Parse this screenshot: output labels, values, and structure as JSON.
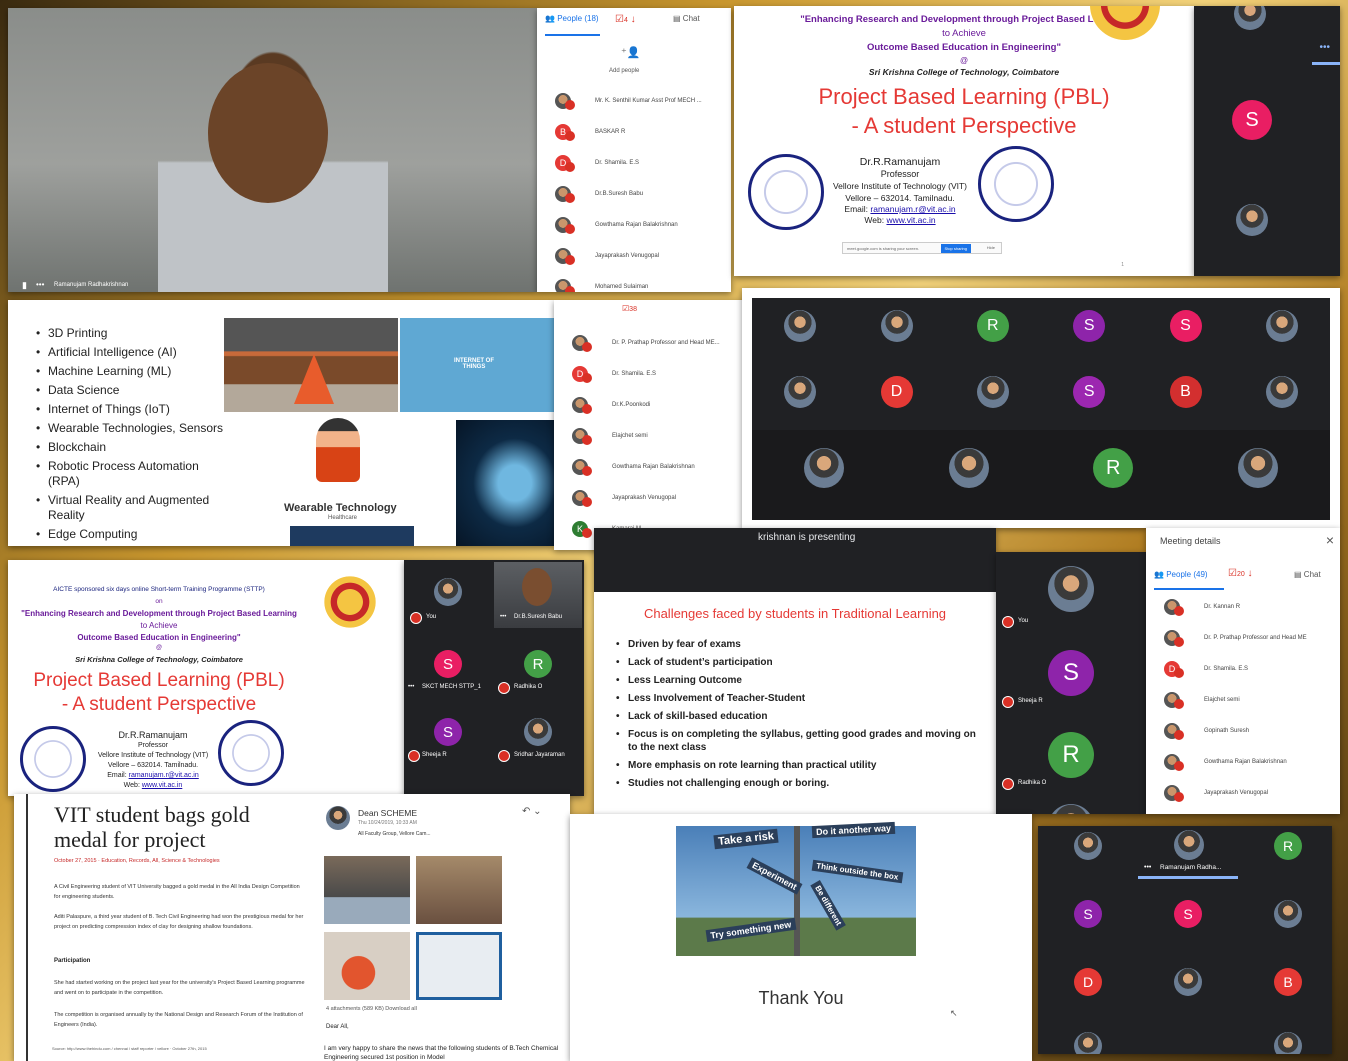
{
  "p1": {
    "name": "Ramanujam Radhakrishnan"
  },
  "people_panel_1": {
    "tab_people": "People (18)",
    "tab_chat": "Chat",
    "count": "4",
    "add_people": "Add people",
    "participants": [
      "Mr. K. Senthil Kumar Asst Prof MECH ...",
      "BASKAR R",
      "Dr. Shamila. E.S",
      "Dr.B.Suresh Babu",
      "Gowthama Rajan Balakrishnan",
      "Jayaprakash Venugopal",
      "Mohamed Sulaiman"
    ],
    "initials": [
      "",
      "B",
      "D",
      "",
      "",
      "",
      ""
    ]
  },
  "slide1": {
    "header1": "\"Enhancing Research and Development through Project Based Learning",
    "header2": "to Achieve",
    "header3": "Outcome Based Education in Engineering\"",
    "at": "@",
    "college": "Sri Krishna College of Technology, Coimbatore",
    "title": "Project Based Learning (PBL)",
    "subtitle": "- A student Perspective",
    "presenter": "Dr.R.Ramanujam",
    "role": "Professor",
    "inst": "Vellore Institute of Technology (VIT)",
    "addr": "Vellore – 632014. Tamilnadu.",
    "email_l": "Email:",
    "email": "ramanujam.r@vit.ac.in",
    "web_l": "Web:",
    "web": "www.vit.ac.in",
    "share_text": "meet.google.com is sharing your screen.",
    "stop_btn": "Stop sharing",
    "hide": "Hide",
    "page": "1"
  },
  "side1": {
    "initial": "S"
  },
  "grid1": {
    "row1": [
      "",
      "",
      "R",
      "S",
      "S",
      ""
    ],
    "row2": [
      "",
      "D",
      "",
      "S",
      "B",
      ""
    ],
    "row3": [
      "",
      "",
      "R",
      ""
    ]
  },
  "topics": {
    "items": [
      "3D Printing",
      "Artificial Intelligence (AI)",
      "Machine Learning (ML)",
      "Data Science",
      "Internet of Things (IoT)",
      "Wearable Technologies, Sensors",
      "Blockchain",
      "Robotic Process Automation (RPA)",
      "Virtual Reality and Augmented Reality",
      "Edge Computing"
    ],
    "iot": "INTERNET OF THINGS",
    "wear": "Wearable Technology",
    "health": "Healthcare"
  },
  "people_panel_2": {
    "count": "38",
    "participants": [
      "Dr. P. Prathap Professor and Head ME...",
      "Dr. Shamila. E.S",
      "Dr.K.Poonkodi",
      "Elajchet semi",
      "Gowthama Rajan Balakrishnan",
      "Jayaprakash Venugopal",
      "Kamaraj M"
    ],
    "initials": [
      "",
      "D",
      "",
      "",
      "",
      "",
      "K"
    ]
  },
  "slide2": {
    "aicte": "AICTE sponsored six days online Short-term Training Programme (STTP)",
    "on": "on",
    "header1": "\"Enhancing Research and Development through Project Based Learning",
    "header2": "to Achieve",
    "header3": "Outcome Based Education in Engineering\"",
    "at": "@",
    "college": "Sri Krishna College of Technology, Coimbatore",
    "title": "Project Based Learning (PBL)",
    "subtitle": "- A student Perspective",
    "presenter": "Dr.R.Ramanujam",
    "role": "Professor",
    "inst": "Vellore Institute of Technology (VIT)",
    "addr": "Vellore – 632014. Tamilnadu.",
    "email_l": "Email:",
    "email": "ramanujam.r@vit.ac.in",
    "web_l": "Web:",
    "web": "www.vit.ac.in"
  },
  "tiles2": {
    "you": "You",
    "babu": "Dr.B.Suresh Babu",
    "skct": "SKCT MECH STTP_1",
    "radhika": "Radhika O",
    "sheeja": "Sheeja R",
    "sridhar": "Sridhar Jayaraman",
    "s": "S",
    "r": "R"
  },
  "challenges": {
    "presenting": "krishnan is presenting",
    "title": "Challenges faced by students in Traditional Learning",
    "items": [
      "Driven by fear of exams",
      "Lack of student’s participation",
      "Less Learning Outcome",
      "Less Involvement of Teacher-Student",
      "Lack of skill-based education",
      "Focus is on completing the syllabus, getting good grades and moving on to the next class",
      "More emphasis on rote learning than practical utility",
      "Studies not challenging enough or boring."
    ]
  },
  "side2": {
    "you": "You",
    "sheeja": "Sheeja R",
    "radhika": "Radhika O",
    "s": "S",
    "r": "R"
  },
  "meeting": {
    "title": "Meeting details",
    "people": "People (49)",
    "count": "20",
    "chat": "Chat",
    "participants": [
      "Dr. Kannan R",
      "Dr. P. Prathap Professor and Head ME",
      "Dr. Shamila. E.S",
      "Elajchet semi",
      "Gopinath Suresh",
      "Gowthama Rajan Balakrishnan",
      "Jayaprakash Venugopal"
    ],
    "initials": [
      "",
      "",
      "D",
      "",
      "",
      "",
      ""
    ]
  },
  "news": {
    "headline": "VIT student bags gold medal for project",
    "date": "October 27, 2015",
    "cats": "Education, Records, All, Science & Technologies",
    "p1": "A Civil Engineering student of VIT University bagged a gold medal in the All India Design Competition for engineering students.",
    "p2": "Aditi Palaspure, a third year student of B. Tech Civil Engineering had won the prestigious medal for her project on predicting compression index of clay for designing shallow foundations.",
    "sub": "Participation",
    "p3": "She had started working on the project last year for the university's Project Based Learning programme and went on to participate in the competition.",
    "p4": "The competition is organised annually by the National Design and Research Forum of the Institution of Engineers (India).",
    "source": "Source: http://www.thehindu.com / chennai / staff reporter / vellore · October 27th, 2015",
    "sender": "Dean SCHEME",
    "sent": "Thu 10/24/2019, 10:33 AM",
    "to": "All Faculty Group, Vellore Cam...",
    "attach": "4 attachments (589 KB)  Download all",
    "dear": "Dear All,",
    "body": "I am very happy to share the news that the following students of B.Tech Chemical Engineering secured 1st position in Model"
  },
  "thanks": {
    "s1": "Take a risk",
    "s2": "Do it another way",
    "s3": "Think outside the box",
    "s4": "Experiment",
    "s5": "Be different",
    "s6": "Try something new",
    "thank": "Thank You"
  },
  "grid3": {
    "name": "Ramanujam Radha...",
    "tiles": [
      "",
      "R",
      "S",
      "S",
      "",
      "D",
      "",
      "B",
      "",
      ""
    ]
  },
  "colors": {
    "accent": "#1a73e8",
    "red": "#d93025",
    "slide_red": "#e53935"
  }
}
